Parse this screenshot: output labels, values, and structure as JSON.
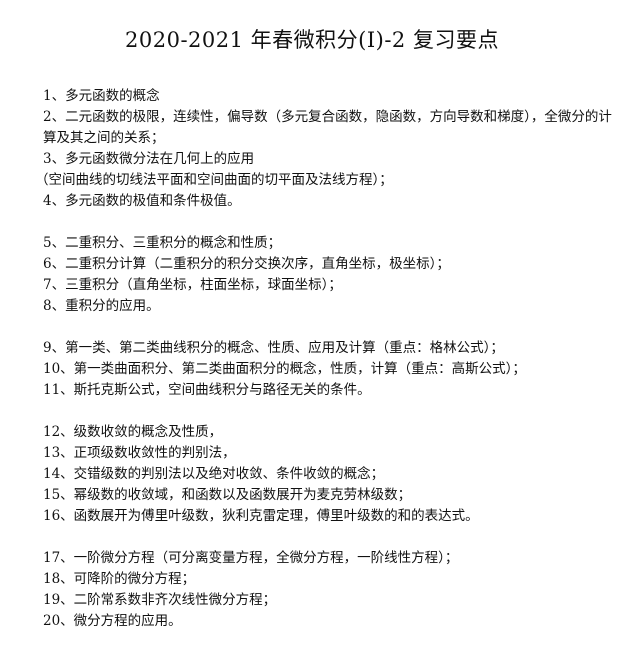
{
  "document": {
    "title": "2020-2021 年春微积分(I)-2 复习要点",
    "groups": [
      {
        "lines": [
          "1、多元函数的概念",
          "2、二元函数的极限，连续性，偏导数（多元复合函数，隐函数，方向导数和梯度），全微分的计算及其之间的关系；",
          "3、多元函数微分法在几何上的应用",
          "（空间曲线的切线法平面和空间曲面的切平面及法线方程）；",
          "4、多元函数的极值和条件极值。"
        ]
      },
      {
        "lines": [
          "5、二重积分、三重积分的概念和性质；",
          "6、二重积分计算（二重积分的积分交换次序，直角坐标，极坐标）；",
          "7、三重积分（直角坐标，柱面坐标，球面坐标）；",
          "8、重积分的应用。"
        ]
      },
      {
        "lines": [
          "9、第一类、第二类曲线积分的概念、性质、应用及计算（重点：格林公式）；",
          "10、第一类曲面积分、第二类曲面积分的概念，性质，计算（重点：高斯公式）；",
          "11、斯托克斯公式，空间曲线积分与路径无关的条件。"
        ]
      },
      {
        "lines": [
          "12、级数收敛的概念及性质，",
          "13、正项级数收敛性的判别法，",
          "14、交错级数的判别法以及绝对收敛、条件收敛的概念；",
          "15、幂级数的收敛域，和函数以及函数展开为麦克劳林级数；",
          "16、函数展开为傅里叶级数，狄利克雷定理，傅里叶级数的和的表达式。"
        ]
      },
      {
        "lines": [
          "17、一阶微分方程（可分离变量方程，全微分方程，一阶线性方程）；",
          "18、可降阶的微分方程；",
          "19、二阶常系数非齐次线性微分方程；",
          "20、微分方程的应用。"
        ]
      }
    ]
  }
}
